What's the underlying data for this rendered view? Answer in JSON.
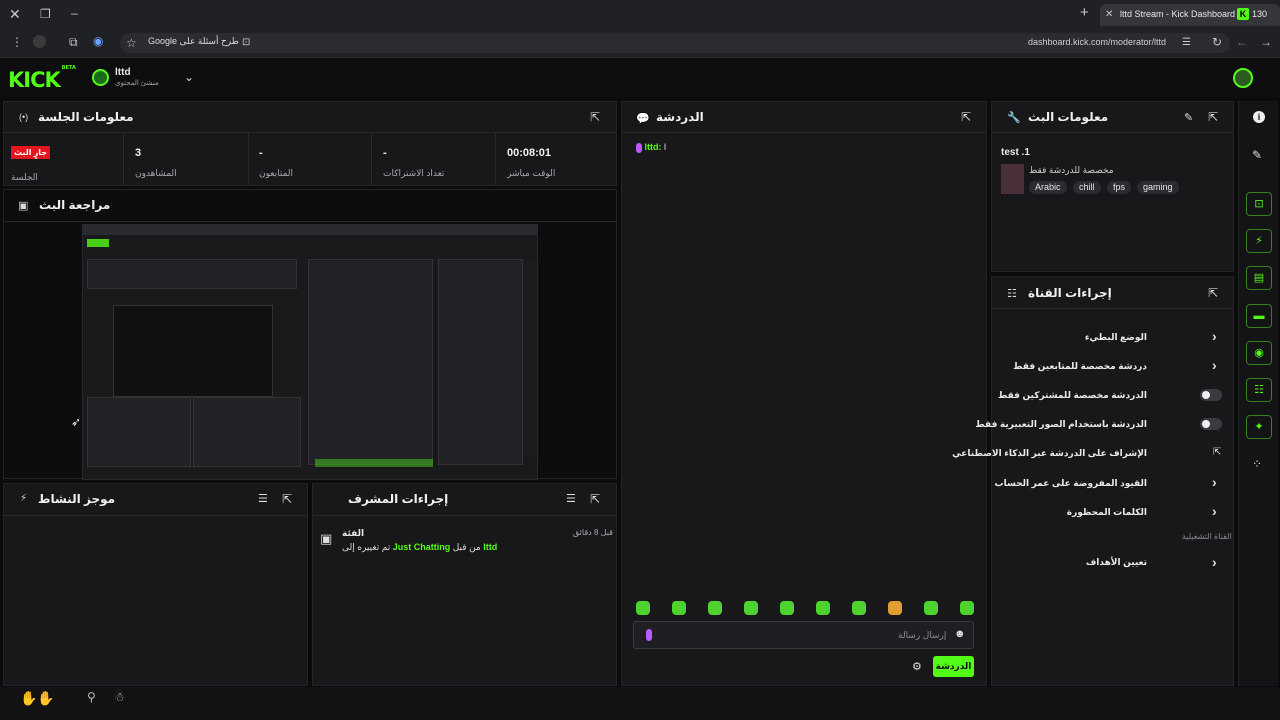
{
  "browser": {
    "tab_title": "lttd Stream - Kick Dashboard",
    "tab_count": "130",
    "address": "dashboard.kick.com/moderator/lttd",
    "search_chip": "طرح أسئلة على Google"
  },
  "header": {
    "logo": "KICK",
    "logo_beta": "BETA",
    "channel_name": "lttd",
    "channel_role": "منشئ المحتوى"
  },
  "session": {
    "title": "معلومات الجلسة",
    "live_badge": "جارٍ البث",
    "session_label": "الجلسة",
    "stats": [
      {
        "value": "3",
        "label": "المشاهدون"
      },
      {
        "value": "-",
        "label": "المتابعون"
      },
      {
        "value": "-",
        "label": "تعداد الاشتراكات"
      },
      {
        "value": "00:08:01",
        "label": "الوقت مباشر"
      }
    ]
  },
  "preview": {
    "title": "مراجعة البث"
  },
  "activity": {
    "title": "موجز النشاط"
  },
  "modactions": {
    "title": "إجراءات المشرف",
    "entry_title": "الفئة",
    "entry_time": "قبل 8 دقائق",
    "entry_by": "lttd",
    "entry_from": "من قبل",
    "entry_changed": "تم تغييره إلى",
    "entry_category": "Just Chatting"
  },
  "chat": {
    "title": "الدردشة",
    "message_user": "lttd:",
    "message_text": "l",
    "input_placeholder": "إرسال رسالة",
    "send_label": "الدردشة"
  },
  "streaminfo": {
    "title": "معلومات البث",
    "stream_title": "test .1",
    "category_note": "مخصصة للدردشة فقط",
    "tags": [
      "Arabic",
      "chill",
      "fps",
      "gaming"
    ]
  },
  "channelactions": {
    "title": "إجراءات القناة",
    "items": [
      {
        "label": "الوضع البطيء",
        "control": "chevron"
      },
      {
        "label": "دردشة مخصصة للمتابعين فقط",
        "control": "chevron"
      },
      {
        "label": "الدردشة مخصصة للمشتركين فقط",
        "control": "toggle"
      },
      {
        "label": "الدردشة باستخدام الصور التعبيرية فقط",
        "control": "toggle"
      },
      {
        "label": "الإشراف على الدردشة عبر الذكاء الاصطناعي",
        "control": "external"
      },
      {
        "label": "القيود المفروضة على عمر الحساب",
        "control": "chevron"
      },
      {
        "label": "الكلمات المحظورة",
        "control": "chevron"
      }
    ],
    "section_label": "القناة التشغيلية",
    "goals_label": "تعيين الأهداف"
  },
  "colors": {
    "accent": "#53fc18",
    "live": "#e5151d",
    "panel": "#18181b",
    "background": "#0b0b0c"
  }
}
